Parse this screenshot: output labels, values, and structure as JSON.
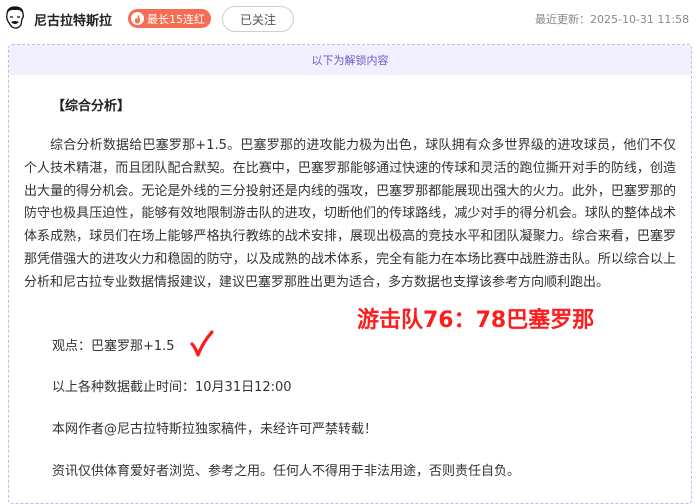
{
  "header": {
    "author_name": "尼古拉特斯拉",
    "streak_badge": "最长15连红",
    "follow_label": "已关注",
    "last_update": "最近更新：2025-10-31 11:58"
  },
  "banner": {
    "unlock_text": "以下为解锁内容"
  },
  "article": {
    "section_title": "【综合分析】",
    "paragraph": "综合分析数据给巴塞罗那+1.5。巴塞罗那的进攻能力极为出色，球队拥有众多世界级的进攻球员，他们不仅个人技术精湛，而且团队配合默契。在比赛中，巴塞罗那能够通过快速的传球和灵活的跑位撕开对手的防线，创造出大量的得分机会。无论是外线的三分投射还是内线的强攻，巴塞罗那都能展现出强大的火力。此外，巴塞罗那的防守也极具压迫性，能够有效地限制游击队的进攻，切断他们的传球路线，减少对手的得分机会。球队的整体战术体系成熟，球员们在场上能够严格执行教练的战术安排，展现出极高的竞技水平和团队凝聚力。综合来看，巴塞罗那凭借强大的进攻火力和稳固的防守，以及成熟的战术体系，完全有能力在本场比赛中战胜游击队。所以综合以上分析和尼古拉专业数据情报建议，建议巴塞罗那胜出更为适合，多方数据也支撑该参考方向顺利跑出。",
    "viewpoint": "观点：巴塞罗那+1.5",
    "data_cutoff": "以上各种数据截止时间：10月31日12:00",
    "copyright": "本网作者@尼古拉特斯拉独家稿件，未经许可严禁转载！",
    "disclaimer": "资讯仅供体育爱好者浏览、参考之用。任何人不得用于非法用途，否则责任自负。"
  },
  "overlay": {
    "score": "游击队76：78巴塞罗那",
    "color": "#ff1c1c"
  },
  "colors": {
    "badge": "#f56e53",
    "banner_bg": "#f2efff",
    "banner_text": "#6b5cc9",
    "border": "#c5b6ee"
  }
}
